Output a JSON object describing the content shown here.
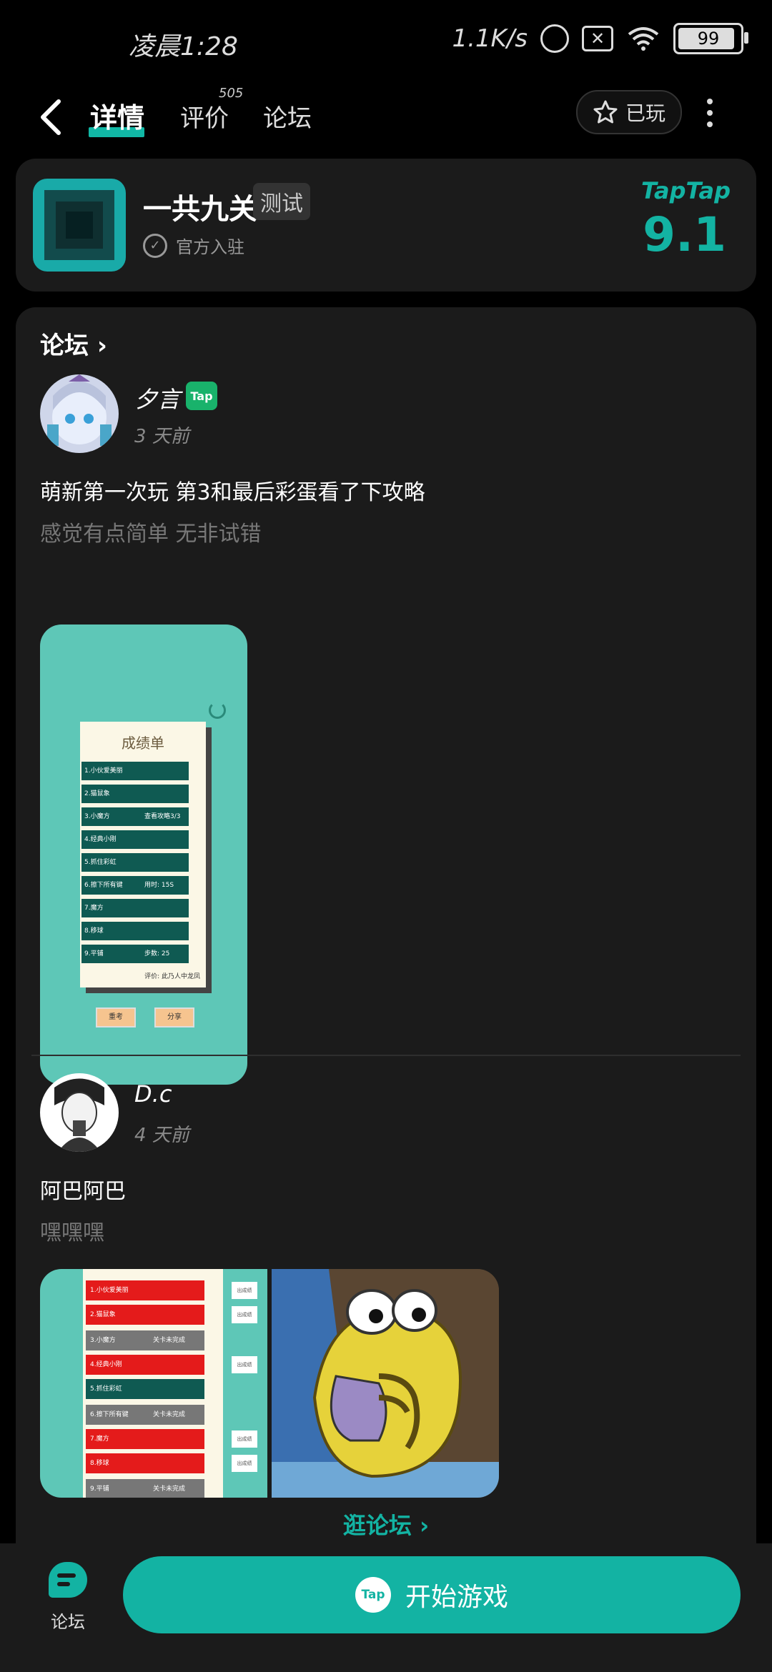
{
  "status_bar": {
    "time": "凌晨1:28",
    "net_speed": "1.1K/s",
    "battery": "99"
  },
  "nav": {
    "tabs": [
      {
        "label": "详情",
        "active": true
      },
      {
        "label": "评价",
        "count": "505"
      },
      {
        "label": "论坛"
      }
    ],
    "played_label": "已玩"
  },
  "game": {
    "title": "一共九关",
    "tag": "测试",
    "official": "官方入驻",
    "brand": "TapTap",
    "score": "9.1"
  },
  "forum": {
    "header": "论坛",
    "posts": [
      {
        "author": "夕言",
        "badge": "Tap",
        "time": "3 天前",
        "title": "萌新第一次玩 第3和最后彩蛋看了下攻略",
        "subtitle": "感觉有点简单 无非试错",
        "image": {
          "title": "成绩单",
          "rows": [
            {
              "label": "1.小伙爱美丽",
              "note": ""
            },
            {
              "label": "2.猫鼠象",
              "note": ""
            },
            {
              "label": "3.小魔方",
              "note": "查看攻略3/3"
            },
            {
              "label": "4.经典小刚",
              "note": ""
            },
            {
              "label": "5.抓住彩虹",
              "note": ""
            },
            {
              "label": "6.擦下所有键",
              "note": "用时: 15S"
            },
            {
              "label": "7.魔方",
              "note": ""
            },
            {
              "label": "8.移球",
              "note": ""
            },
            {
              "label": "9.平铺",
              "note": "步数: 25"
            }
          ],
          "rating": "评价: 此乃人中龙凤",
          "buttons": [
            "重考",
            "分享"
          ]
        }
      },
      {
        "author": "D.c",
        "time": "4 天前",
        "title": "阿巴阿巴",
        "subtitle": "嘿嘿嘿",
        "image": {
          "rows": [
            {
              "label": "1.小伙爱美丽",
              "note": "",
              "color": "#e41b1b"
            },
            {
              "label": "2.猫鼠象",
              "note": "",
              "color": "#e41b1b"
            },
            {
              "label": "3.小魔方",
              "note": "关卡未完成",
              "color": "#777777"
            },
            {
              "label": "4.经典小刚",
              "note": "",
              "color": "#e41b1b"
            },
            {
              "label": "5.抓住彩虹",
              "note": "",
              "color": "#0f5a52"
            },
            {
              "label": "6.擦下所有键",
              "note": "关卡未完成",
              "color": "#777777"
            },
            {
              "label": "7.魔方",
              "note": "",
              "color": "#e41b1b"
            },
            {
              "label": "8.移球",
              "note": "",
              "color": "#e41b1b"
            },
            {
              "label": "9.平铺",
              "note": "关卡未完成",
              "color": "#777777"
            }
          ],
          "mini_label": "出成绩"
        }
      }
    ],
    "browse_label": "逛论坛"
  },
  "bottom": {
    "forum_label": "论坛",
    "start_label": "开始游戏",
    "tap_logo": "Tap"
  },
  "colors": {
    "accent": "#13b3a3",
    "card_bg": "#1b1b1b"
  }
}
